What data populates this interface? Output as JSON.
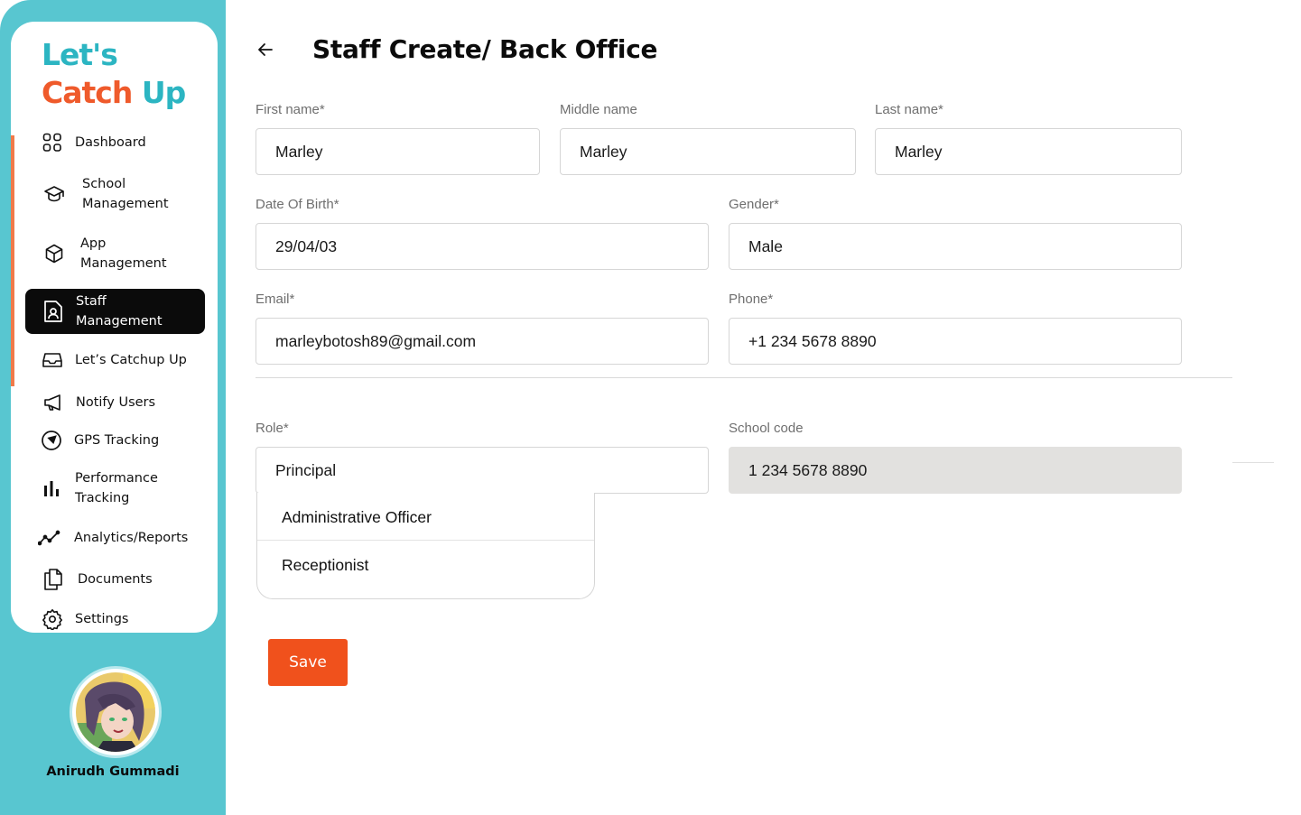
{
  "sidebar": {
    "logo": {
      "line1": "Let's",
      "line2_a": "Catch",
      "line2_b": "Up"
    },
    "items": [
      {
        "label": "Dashboard",
        "icon": "grid-icon"
      },
      {
        "label": "School Management",
        "icon": "graduation-cap-icon"
      },
      {
        "label": "App Management",
        "icon": "cube-icon"
      },
      {
        "label": "Staff Management",
        "icon": "staff-badge-icon",
        "active": true
      },
      {
        "label": "Let’s Catchup Up",
        "icon": "inbox-icon"
      },
      {
        "label": "Notify Users",
        "icon": "megaphone-icon"
      },
      {
        "label": "GPS Tracking",
        "icon": "navigation-icon"
      },
      {
        "label": "Performance Tracking",
        "icon": "bar-chart-icon"
      },
      {
        "label": "Analytics/Reports",
        "icon": "trend-line-icon"
      },
      {
        "label": "Documents",
        "icon": "documents-icon"
      },
      {
        "label": "Settings",
        "icon": "gear-icon"
      }
    ],
    "user": {
      "name": "Anirudh Gummadi"
    }
  },
  "header": {
    "title": "Staff Create/ Back Office"
  },
  "form": {
    "first_name": {
      "label": "First name*",
      "value": "Marley"
    },
    "middle_name": {
      "label": "Middle name",
      "value": "Marley"
    },
    "last_name": {
      "label": "Last name*",
      "value": "Marley"
    },
    "dob": {
      "label": "Date Of Birth*",
      "value": "29/04/03"
    },
    "gender": {
      "label": "Gender*",
      "value": "Male"
    },
    "email": {
      "label": "Email*",
      "value": "marleybotosh89@gmail.com"
    },
    "phone": {
      "label": "Phone*",
      "value": "+1 234 5678 8890"
    },
    "role": {
      "label": "Role*",
      "value": "Principal",
      "options": [
        "Administrative Officer",
        "Receptionist"
      ]
    },
    "school_code": {
      "label": "School code",
      "value": "1 234 5678 8890"
    }
  },
  "actions": {
    "save_label": "Save"
  },
  "colors": {
    "sidebar_bg": "#58c6d0",
    "accent_orange": "#f0511c",
    "logo_teal": "#2cb5c2",
    "logo_orange": "#ef5a2b"
  }
}
